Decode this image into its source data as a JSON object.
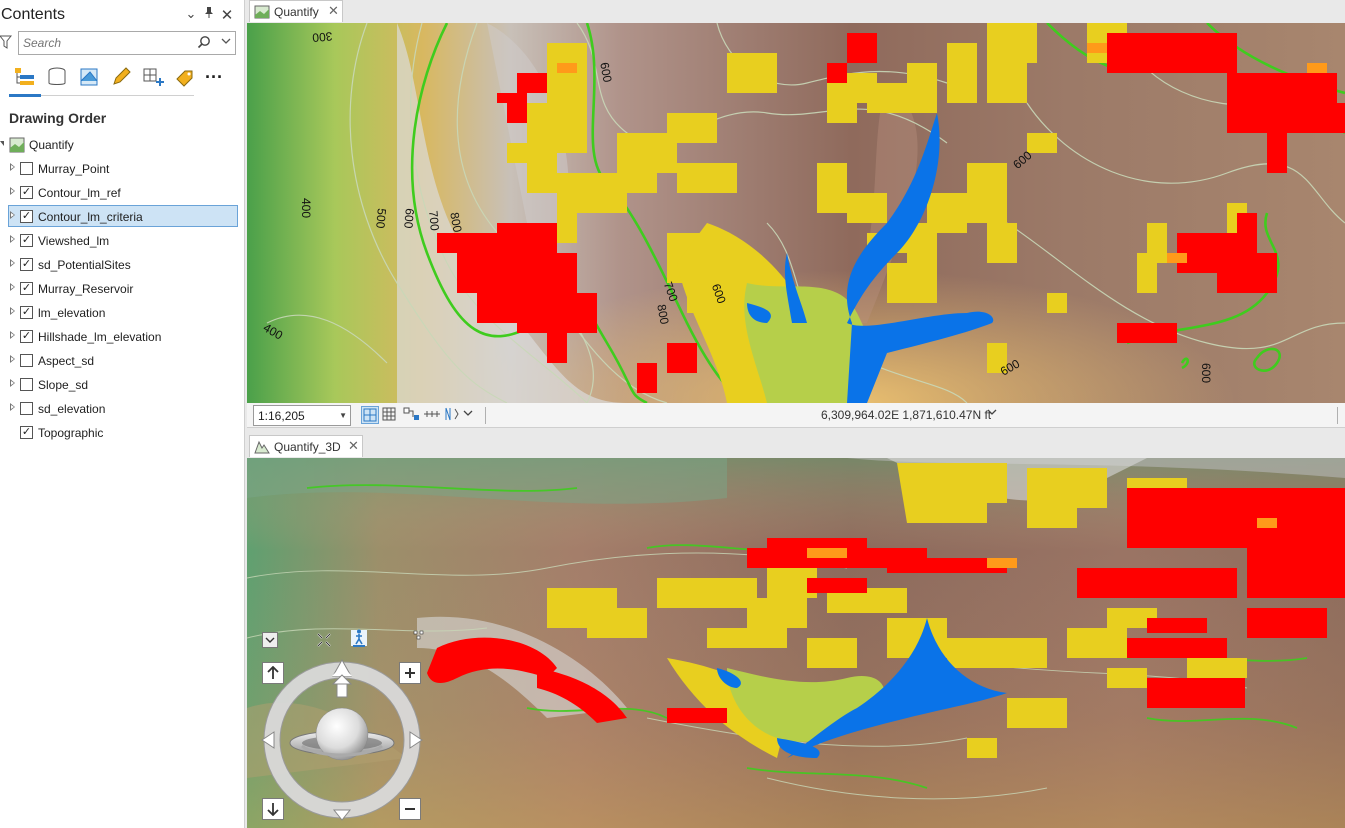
{
  "contents": {
    "title": "Contents",
    "search": {
      "placeholder": "Search"
    },
    "section_title": "Drawing Order",
    "map_name": "Quantify",
    "layers": [
      {
        "name": "Murray_Point",
        "checked": false,
        "expandable": true,
        "selected": false
      },
      {
        "name": "Contour_lm_ref",
        "checked": true,
        "expandable": true,
        "selected": false
      },
      {
        "name": "Contour_lm_criteria",
        "checked": true,
        "expandable": true,
        "selected": true
      },
      {
        "name": "Viewshed_lm",
        "checked": true,
        "expandable": true,
        "selected": false
      },
      {
        "name": "sd_PotentialSites",
        "checked": true,
        "expandable": true,
        "selected": false
      },
      {
        "name": "Murray_Reservoir",
        "checked": true,
        "expandable": true,
        "selected": false
      },
      {
        "name": "lm_elevation",
        "checked": true,
        "expandable": true,
        "selected": false
      },
      {
        "name": "Hillshade_lm_elevation",
        "checked": true,
        "expandable": true,
        "selected": false
      },
      {
        "name": "Aspect_sd",
        "checked": false,
        "expandable": true,
        "selected": false
      },
      {
        "name": "Slope_sd",
        "checked": false,
        "expandable": true,
        "selected": false
      },
      {
        "name": "sd_elevation",
        "checked": false,
        "expandable": true,
        "selected": false
      },
      {
        "name": "Topographic",
        "checked": true,
        "expandable": false,
        "selected": false
      }
    ]
  },
  "tabs": {
    "map2d": "Quantify",
    "map3d": "Quantify_3D"
  },
  "statusbar": {
    "scale": "1:16,205",
    "coordinates": "6,309,964.02E 1,871,610.47N ft"
  },
  "map2d_labels": {
    "c300": "300",
    "c400a": "400",
    "c400b": "400",
    "c500": "500",
    "c600a": "600",
    "c600b": "600",
    "c600c": "600",
    "c600d": "600",
    "c600e": "600",
    "c600f": "600",
    "c700a": "700",
    "c700b": "700",
    "c800a": "800",
    "c800b": "800"
  },
  "colors": {
    "viewshed": "#ff0000",
    "potential_sites": "#e8cf1f",
    "reservoir": "#0a73e8",
    "criteria_contour": "#3fcc1e",
    "ref_contour": "#c9d8b8",
    "selection": "#cde3f5"
  }
}
